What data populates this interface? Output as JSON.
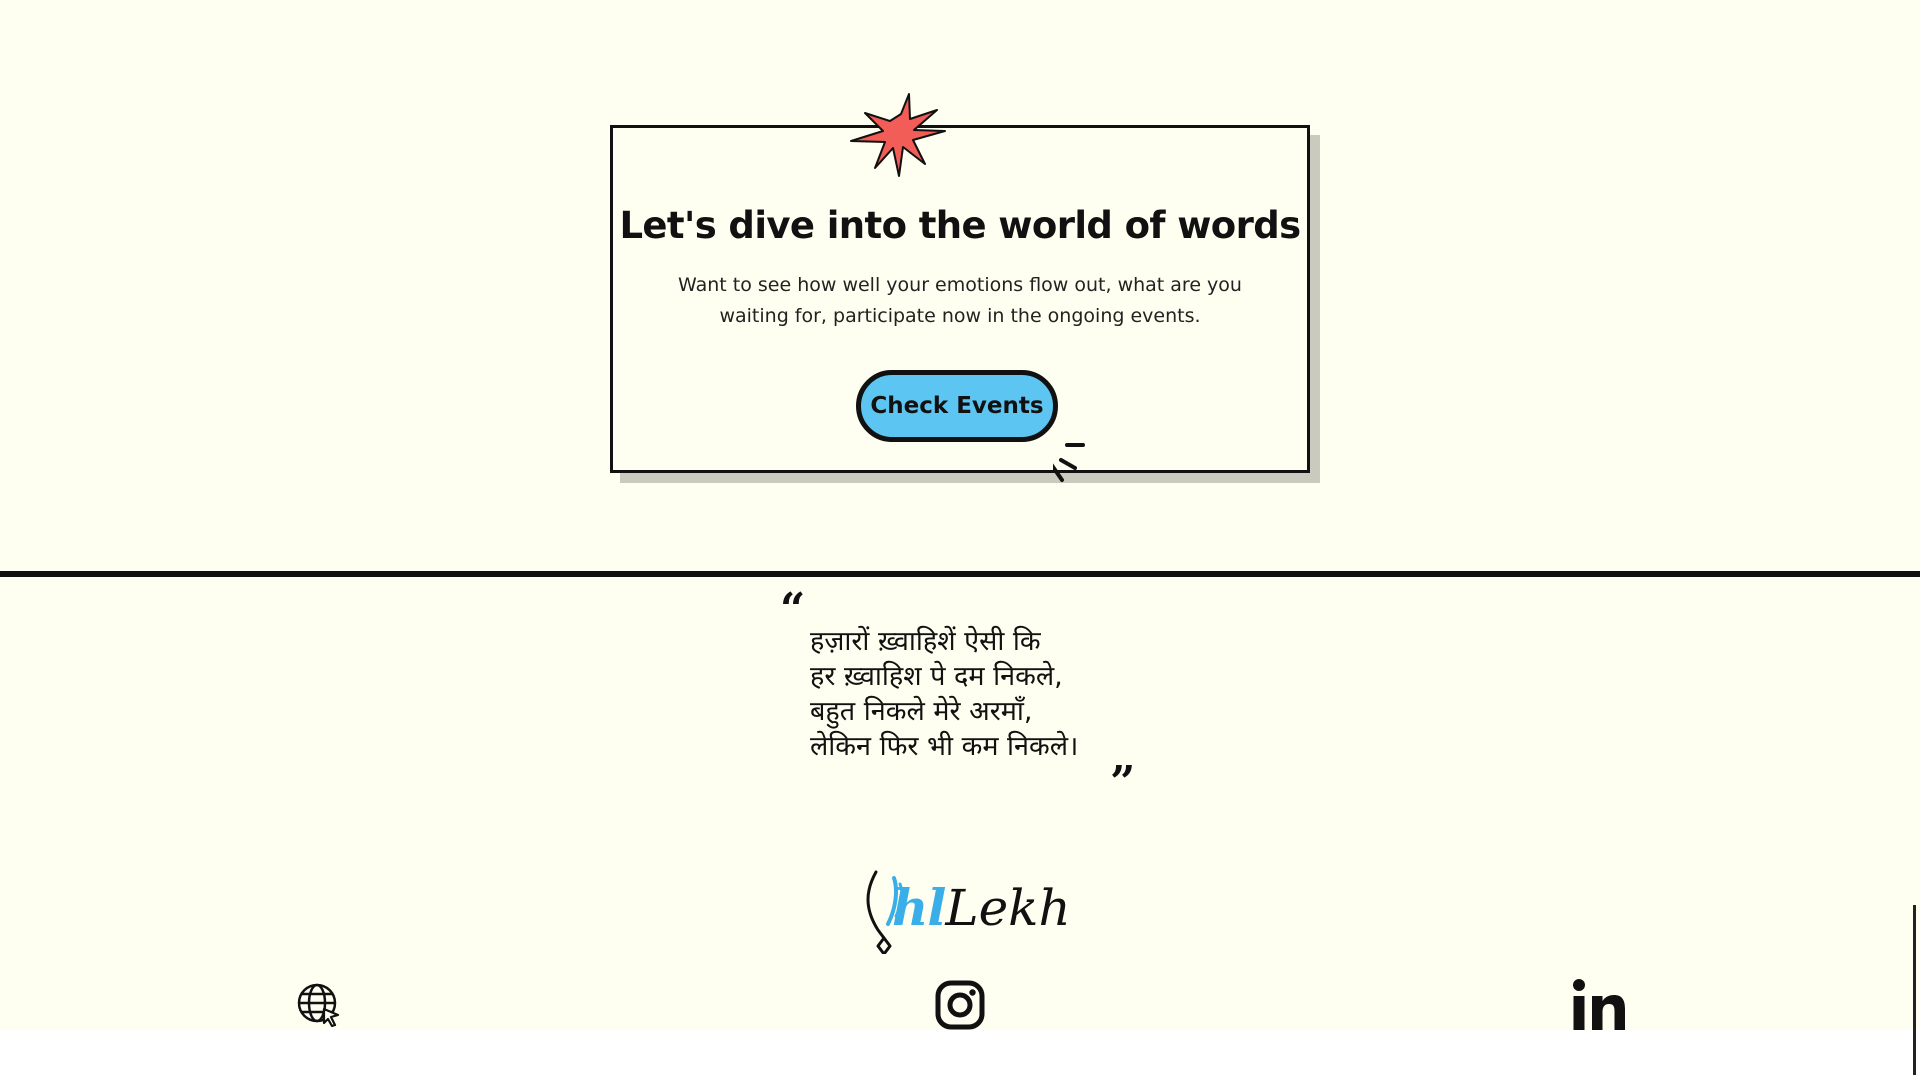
{
  "cta": {
    "title": "Let's dive into the world of words",
    "description": "Want to see how well your emotions flow out, what are you waiting for, participate now in the ongoing events.",
    "button_label": "Check Events",
    "button_color": "#5cc5f2",
    "burst_color": "#f25d57"
  },
  "quote": {
    "open_mark": "“",
    "close_mark": "”",
    "lines": [
      "हज़ारों ख़्वाहिशें ऐसी कि",
      "हर ख़्वाहिश पे दम निकले,",
      "बहुत निकले मेरे अरमाँ,",
      "लेकिन फिर भी कम निकले।"
    ]
  },
  "logo": {
    "part1": "hl",
    "part2": "Lekh",
    "accent": "#3aaee8"
  },
  "social": {
    "website_icon": "globe-cursor-icon",
    "instagram_icon": "instagram-icon",
    "linkedin_icon": "linkedin-icon"
  },
  "colors": {
    "background": "#fefff0",
    "ink": "#111111"
  }
}
